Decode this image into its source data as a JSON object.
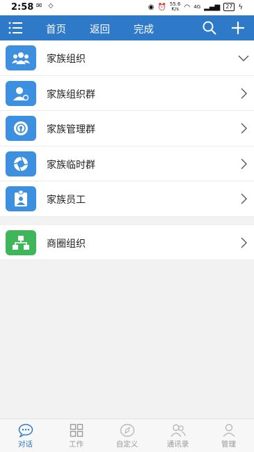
{
  "status": {
    "time": "2:58",
    "net_speed_value": "55.6",
    "net_speed_unit": "K/s",
    "signal_label": "4G",
    "battery": "27"
  },
  "topbar": {
    "home": "首页",
    "back": "返回",
    "done": "完成"
  },
  "list": {
    "items": [
      {
        "label": "家族组织"
      },
      {
        "label": "家族组织群"
      },
      {
        "label": "家族管理群"
      },
      {
        "label": "家族临时群"
      },
      {
        "label": "家族员工"
      },
      {
        "label": "商圈组织"
      }
    ]
  },
  "bottom_nav": {
    "items": [
      {
        "label": "对话"
      },
      {
        "label": "工作"
      },
      {
        "label": "自定义"
      },
      {
        "label": "通讯录"
      },
      {
        "label": "管理"
      }
    ]
  },
  "colors": {
    "accent": "#2e7ac8",
    "icon_blue": "#3d8fe0",
    "icon_green": "#3fb65a"
  }
}
